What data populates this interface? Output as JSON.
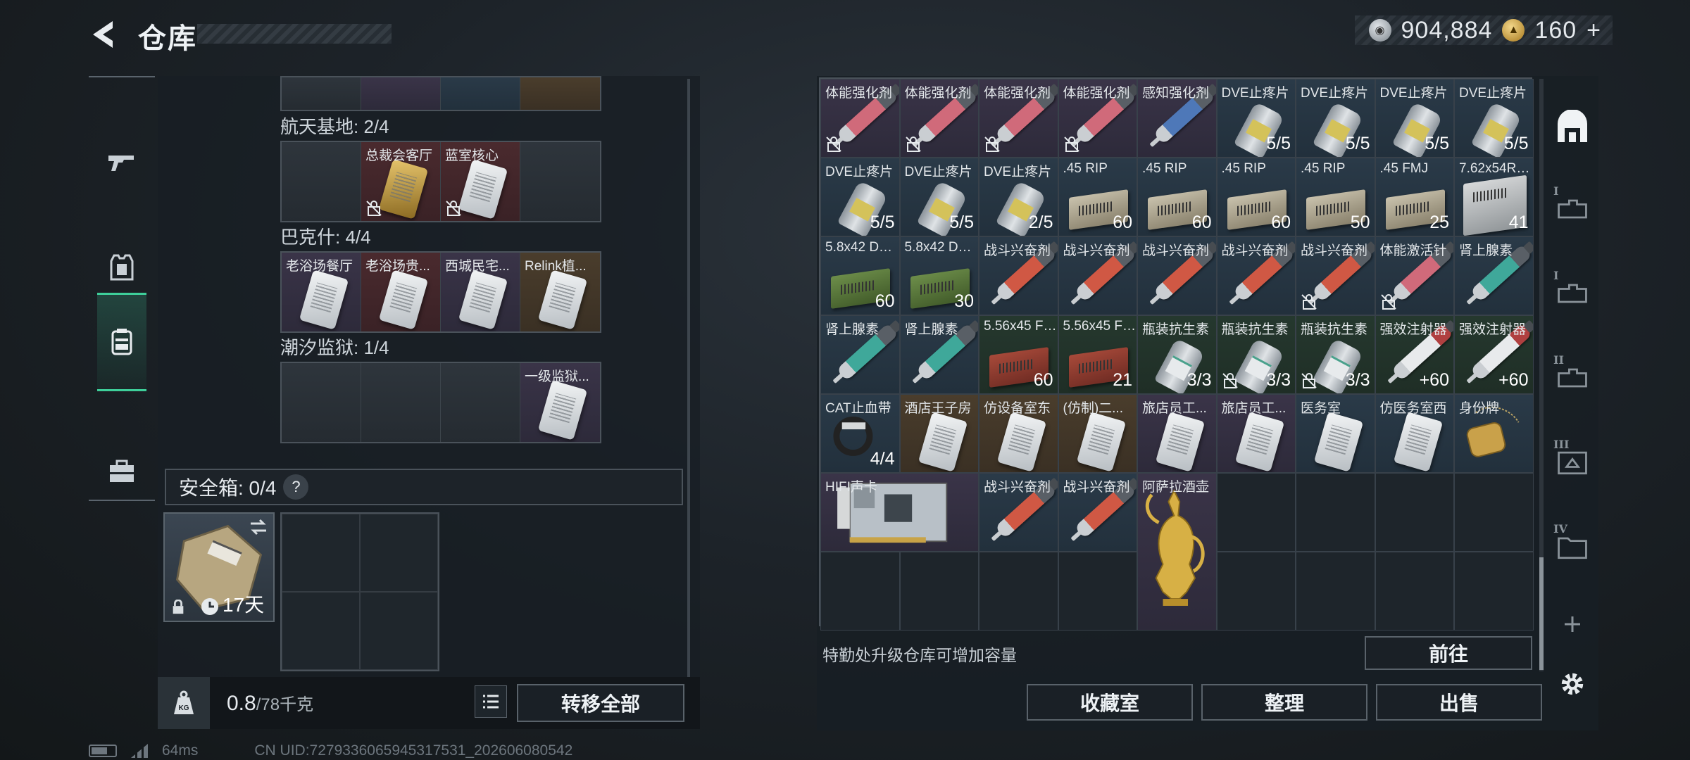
{
  "header": {
    "title": "仓库",
    "silver": "904,884",
    "gold": "160",
    "gold_plus": "+"
  },
  "left_tabs": [
    "gun-tab",
    "armor-tab",
    "container-tab",
    "toolbox-tab"
  ],
  "sections": [
    {
      "label": "航天基地: 2/4",
      "items": [
        {
          "name": "",
          "bg": "gray",
          "empty": true
        },
        {
          "name": "总裁会客厅",
          "bg": "red",
          "kind": "goldcard",
          "locked": true
        },
        {
          "name": "蓝室核心",
          "bg": "red",
          "kind": "card",
          "locked": true
        },
        {
          "name": "",
          "bg": "gray",
          "empty": true
        }
      ]
    },
    {
      "label": "巴克什: 4/4",
      "items": [
        {
          "name": "老浴场餐厅",
          "bg": "purple",
          "kind": "card"
        },
        {
          "name": "老浴场贵...",
          "bg": "red",
          "kind": "card"
        },
        {
          "name": "西城民宅...",
          "bg": "purple",
          "kind": "card"
        },
        {
          "name": "Relink植...",
          "bg": "gold",
          "kind": "card"
        }
      ]
    },
    {
      "label": "潮汐监狱: 1/4",
      "items": [
        {
          "name": "",
          "bg": "gray",
          "empty": true
        },
        {
          "name": "",
          "bg": "gray",
          "empty": true
        },
        {
          "name": "",
          "bg": "gray",
          "empty": true
        },
        {
          "name": "一级监狱...",
          "bg": "purple",
          "kind": "card"
        }
      ]
    }
  ],
  "safe": {
    "label": "安全箱: 0/4",
    "help": "?",
    "duration": "17天"
  },
  "capacity": {
    "current": "0.8",
    "max": "/78千克",
    "transfer": "转移全部"
  },
  "status": {
    "ping": "64ms",
    "uid": "CN UID:7279336065945317531_202606080542"
  },
  "storage": {
    "items": [
      {
        "name": "体能强化剂",
        "kind": "sy-pink",
        "bg": "purple",
        "locked": true
      },
      {
        "name": "体能强化剂",
        "kind": "sy-pink",
        "bg": "purple",
        "locked": true
      },
      {
        "name": "体能强化剂",
        "kind": "sy-pink",
        "bg": "purple",
        "locked": true
      },
      {
        "name": "体能强化剂",
        "kind": "sy-pink",
        "bg": "purple",
        "locked": true
      },
      {
        "name": "感知强化剂",
        "kind": "sy-blue",
        "bg": "purple"
      },
      {
        "name": "DVE止疼片",
        "kind": "bottle",
        "bg": "blue",
        "count": "5/5"
      },
      {
        "name": "DVE止疼片",
        "kind": "bottle",
        "bg": "blue",
        "count": "5/5"
      },
      {
        "name": "DVE止疼片",
        "kind": "bottle",
        "bg": "blue",
        "count": "5/5"
      },
      {
        "name": "DVE止疼片",
        "kind": "bottle",
        "bg": "blue",
        "count": "5/5"
      },
      {
        "name": "DVE止疼片",
        "kind": "bottle",
        "bg": "blue",
        "count": "5/5"
      },
      {
        "name": "DVE止疼片",
        "kind": "bottle",
        "bg": "blue",
        "count": "5/5"
      },
      {
        "name": "DVE止疼片",
        "kind": "bottle",
        "bg": "blue",
        "count": "2/5"
      },
      {
        "name": ".45 RIP",
        "kind": "ammo",
        "bg": "blue",
        "count": "60"
      },
      {
        "name": ".45 RIP",
        "kind": "ammo",
        "bg": "blue",
        "count": "60"
      },
      {
        "name": ".45 RIP",
        "kind": "ammo",
        "bg": "blue",
        "count": "60"
      },
      {
        "name": ".45 RIP",
        "kind": "ammo",
        "bg": "blue",
        "count": "50"
      },
      {
        "name": ".45 FMJ",
        "kind": "ammo",
        "bg": "blue",
        "count": "25"
      },
      {
        "name": "7.62x54R T46M",
        "kind": "ammo bigbox",
        "bg": "blue",
        "count": "41"
      },
      {
        "name": "5.8x42 DVP88",
        "kind": "ammo green",
        "bg": "blue",
        "count": "60"
      },
      {
        "name": "5.8x42 DVP88",
        "kind": "ammo green",
        "bg": "blue",
        "count": "30"
      },
      {
        "name": "战斗兴奋剂",
        "kind": "sy-red",
        "bg": "blue"
      },
      {
        "name": "战斗兴奋剂",
        "kind": "sy-red",
        "bg": "blue"
      },
      {
        "name": "战斗兴奋剂",
        "kind": "sy-red",
        "bg": "blue"
      },
      {
        "name": "战斗兴奋剂",
        "kind": "sy-red",
        "bg": "blue"
      },
      {
        "name": "战斗兴奋剂",
        "kind": "sy-red",
        "bg": "blue",
        "locked": true
      },
      {
        "name": "体能激活针",
        "kind": "sy-pink",
        "bg": "blue",
        "locked": true
      },
      {
        "name": "肾上腺素",
        "kind": "sy-teal",
        "bg": "blue"
      },
      {
        "name": "肾上腺素",
        "kind": "sy-teal",
        "bg": "blue"
      },
      {
        "name": "肾上腺素",
        "kind": "sy-teal",
        "bg": "blue"
      },
      {
        "name": "5.56x45 FMJ",
        "kind": "ammo redbox",
        "bg": "green",
        "count": "60"
      },
      {
        "name": "5.56x45 FMJ",
        "kind": "ammo redbox",
        "bg": "green",
        "count": "21"
      },
      {
        "name": "瓶装抗生素",
        "kind": "bottle white",
        "bg": "green",
        "count": "3/3"
      },
      {
        "name": "瓶装抗生素",
        "kind": "bottle white",
        "bg": "green",
        "count": "3/3",
        "locked": true
      },
      {
        "name": "瓶装抗生素",
        "kind": "bottle white",
        "bg": "green",
        "count": "3/3",
        "locked": true
      },
      {
        "name": "强效注射器",
        "kind": "sy-white",
        "bg": "green",
        "count": "+60"
      },
      {
        "name": "强效注射器",
        "kind": "sy-white",
        "bg": "green",
        "count": "+60"
      },
      {
        "name": "CAT止血带",
        "kind": "tourniquet",
        "bg": "blue",
        "count": "4/4"
      },
      {
        "name": "酒店王子房",
        "kind": "card",
        "bg": "gold"
      },
      {
        "name": "仿设备室东",
        "kind": "card",
        "bg": "gold"
      },
      {
        "name": "(仿制)二...",
        "kind": "card",
        "bg": "gold"
      },
      {
        "name": "旅店员工...",
        "kind": "card",
        "bg": "purple"
      },
      {
        "name": "旅店员工...",
        "kind": "card",
        "bg": "purple"
      },
      {
        "name": "医务室",
        "kind": "card",
        "bg": "blue"
      },
      {
        "name": "仿医务室西",
        "kind": "card",
        "bg": "blue"
      },
      {
        "name": "身份牌",
        "kind": "tag",
        "bg": "blue"
      },
      {
        "name": "HIFI声卡",
        "kind": "soundcard",
        "bg": "purple",
        "span": 2
      },
      {
        "name": "战斗兴奋剂",
        "kind": "sy-red",
        "bg": "blue"
      },
      {
        "name": "战斗兴奋剂",
        "kind": "sy-red",
        "bg": "blue"
      },
      {
        "name": "阿萨拉酒壶",
        "kind": "ewer",
        "bg": "purple",
        "vspan": 2
      }
    ],
    "upgrade_hint": "特勤处升级仓库可增加容量",
    "goto": "前往",
    "buttons": {
      "collection": "收藏室",
      "sort": "整理",
      "sell": "出售"
    }
  },
  "right_tabs": [
    "storage-main",
    "I",
    "I",
    "II",
    "III",
    "IV",
    "+"
  ]
}
